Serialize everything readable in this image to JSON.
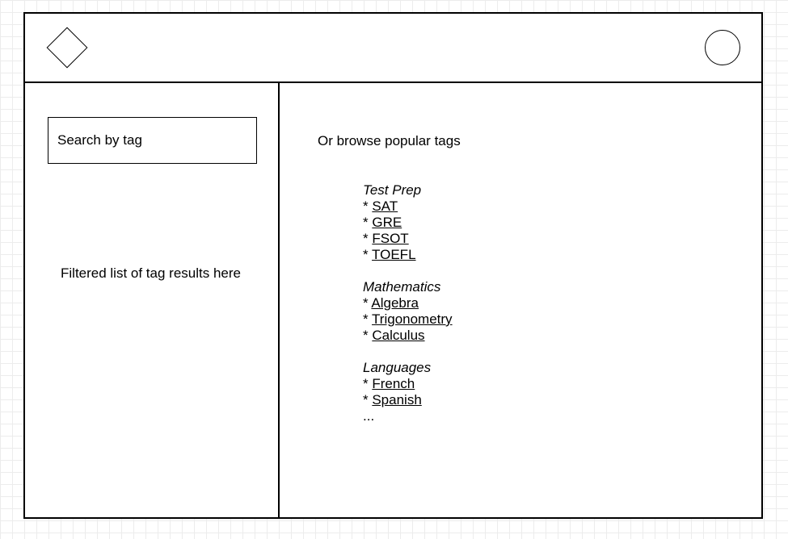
{
  "search": {
    "placeholder": "Search by tag"
  },
  "results": {
    "placeholder_text": "Filtered list of tag results here"
  },
  "browse": {
    "label": "Or browse popular tags",
    "bullet": "* ",
    "groups": [
      {
        "title": "Test Prep",
        "tags": [
          "SAT",
          "GRE",
          "FSOT",
          "TOEFL"
        ]
      },
      {
        "title": "Mathematics",
        "tags": [
          "Algebra",
          "Trigonometry",
          "Calculus"
        ]
      },
      {
        "title": "Languages",
        "tags": [
          "French",
          "Spanish"
        ]
      }
    ],
    "more": "..."
  }
}
